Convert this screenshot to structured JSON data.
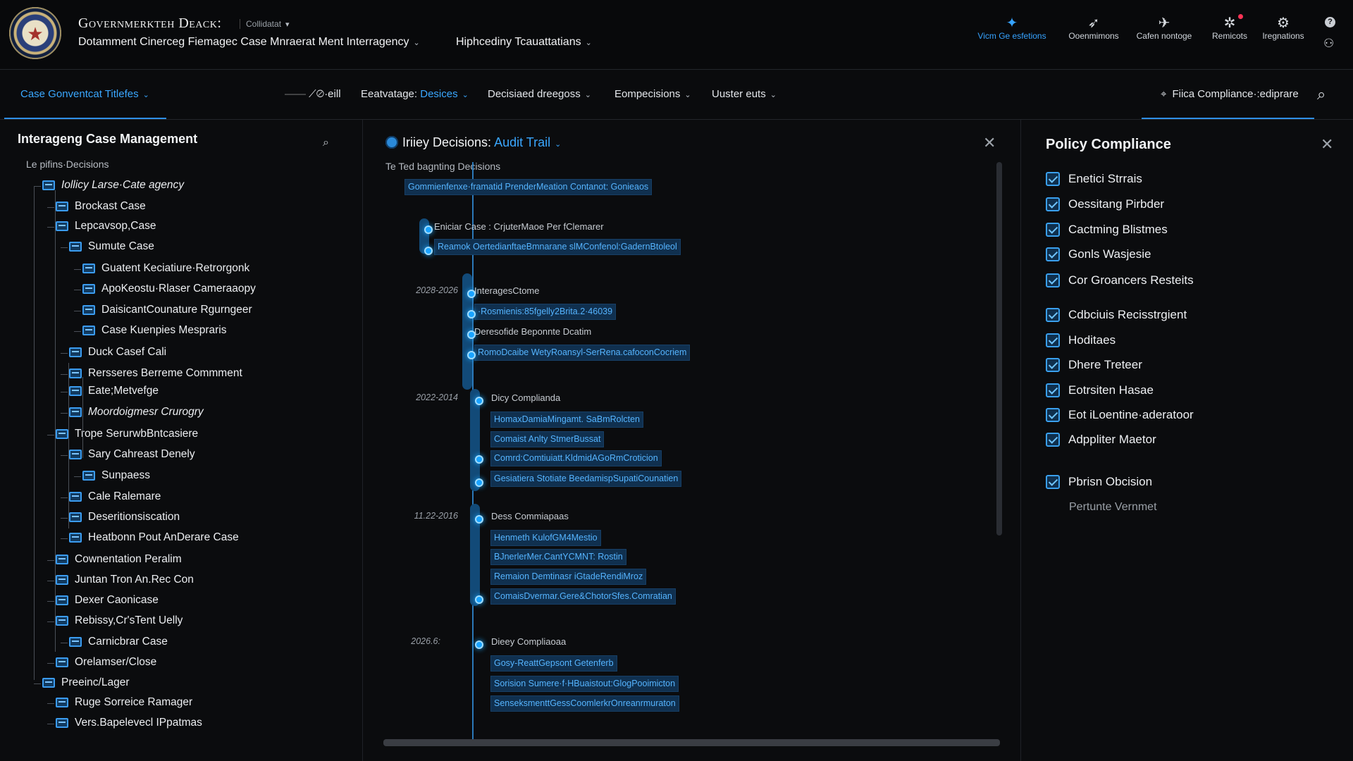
{
  "header": {
    "app_title": "Governmerkteh Deack:",
    "app_sub": "Collidatat",
    "breadcrumb_main": "Dotamment Cinerceg Fiemagec Case Mnraerat Ment Interragency",
    "breadcrumb_secondary": "Hiphcediny Tcauattatians",
    "actions": [
      {
        "label": "Vicm Ge esfetions",
        "icon": "shield-check-icon",
        "glyph": "✦",
        "active": true
      },
      {
        "label": "Ooenmimons",
        "icon": "paper-plane-icon",
        "glyph": "➶",
        "active": false
      },
      {
        "label": "Cafen nontoge",
        "icon": "rocket-icon",
        "glyph": "✈",
        "active": false
      },
      {
        "label": "Remicots",
        "icon": "gear-alert-icon",
        "glyph": "✲",
        "active": false
      },
      {
        "label": "Iregnations",
        "icon": "gears-icon",
        "glyph": "⚙",
        "active": false
      }
    ]
  },
  "nav": {
    "item1": "Case Gonventcat Titlefes",
    "item2": "⟋⊘·eill",
    "item3_prefix": "Eeatvatage:",
    "item3_value": "Desices",
    "item4": "Decisiaed dreegoss",
    "item5": "Eompecisions",
    "item6": "Uuster euts",
    "compliance": "Fiica Compliance·:ediprare"
  },
  "left": {
    "title": "Interageng Case Management",
    "caption": "Le pifins·Decisions",
    "tree": [
      {
        "label": "Iollicy Larse·Cate agency",
        "depth": 0,
        "italic": true
      },
      {
        "label": "Brockast Case",
        "depth": 1
      },
      {
        "label": "Lepcavsop,Case",
        "depth": 1
      },
      {
        "label": "Sumute Case",
        "depth": 2
      },
      {
        "label": "Guatent Keciatiure·Retrorgonk",
        "depth": 3
      },
      {
        "label": "ApoKeostu·Rlaser Cameraaopy",
        "depth": 3
      },
      {
        "label": "DaisicantCounature Rgurngeer",
        "depth": 3
      },
      {
        "label": "Case Kuenpies Mespraris",
        "depth": 3
      },
      {
        "label": "Duck Casef Cali",
        "depth": 2
      },
      {
        "label": "Rersseres Berreme Commment",
        "depth": 2
      },
      {
        "label": "Eate;Metvefge",
        "depth": 2
      },
      {
        "label": "Moordoigmesr Crurogry",
        "depth": 2,
        "italic": true
      },
      {
        "label": "Trope SerurwbBntcasiere",
        "depth": 1
      },
      {
        "label": "Sary Cahreast Denely",
        "depth": 2
      },
      {
        "label": "Sunpaess",
        "depth": 3
      },
      {
        "label": "Cale Ralemare",
        "depth": 2
      },
      {
        "label": "Deseritionsiscation",
        "depth": 2
      },
      {
        "label": "Heatbonn Pout AnDerare Case",
        "depth": 2
      },
      {
        "label": "Cownentation Peralim",
        "depth": 1
      },
      {
        "label": "Juntan Tron An.Rec Con",
        "depth": 1
      },
      {
        "label": "Dexer Caonicase",
        "depth": 1
      },
      {
        "label": "Rebissy,Cr'sTent Uelly",
        "depth": 1
      },
      {
        "label": "Carnicbrar Case",
        "depth": 2
      },
      {
        "label": "Orelamser/Close",
        "depth": 1
      },
      {
        "label": "Preeinc/Lager",
        "depth": 0
      },
      {
        "label": "Ruge Sorreice Ramager",
        "depth": 1
      },
      {
        "label": "Vers.Bapelevecl IPpatmas",
        "depth": 1
      }
    ]
  },
  "center": {
    "title_prefix": "Iriiey Decisions:",
    "title_value": "Audit Trail",
    "caption": "Te Ted bagnting Decisions",
    "root_item": "Gommienfenxe·framatid PrenderMeation Contanot: Gonieaos",
    "groups": [
      {
        "label": "Eniciar Case : CrjuterMaoe Per fClemarer",
        "date": "",
        "items": [
          "Reamok OertedianftaeBmnarane slMConfenol:GadernBtoleol"
        ]
      },
      {
        "label": "InteragesCtome",
        "date": "2028-2026",
        "items": [
          "·Rosmienis:85fgelly2Brita.2·46039"
        ]
      },
      {
        "label": "Deresofide Beponnte Dcatim",
        "date": "",
        "items": [
          "RomoDcaibe WetyRoansyl-SerRena.cafoconCocriem"
        ]
      },
      {
        "label": "Dicy Complianda",
        "date": "2022-2014",
        "items": [
          "HomaxDamiaMingamt. SaBmRolcten",
          "Comaist Anlty StmerBussat",
          "Comrd:Comtiuiatt.KldmidAGoRmCroticion",
          "Gesiatiera Stotiate BeedamispSupatiCounatien"
        ]
      },
      {
        "label": "Dess Commiapaas",
        "date": "11.22-2016",
        "items": [
          "Henmeth KulofGM4Mestio",
          "BJnerlerMer.CantYCMNT: Rostin",
          "Remaion Demtinasr iGtadeRendiMroz",
          "ComaisDvermar.Gere&ChotorSfes.Comratian"
        ]
      },
      {
        "label": "Dieey Compliaoaa",
        "date": "2026.6:",
        "items": [
          "Gosy-ReattGepsont Getenferb",
          "Sorision Sumere·f·HBuaistout:GlogPooimicton",
          "SenseksmenttGessCoomlerkrOnreanrmuraton"
        ]
      }
    ]
  },
  "right": {
    "title": "Policy Compliance",
    "items": [
      "Enetici Strrais",
      "Oessitang Pirbder",
      "Cactming Blistmes",
      "Gonls Wasjesie",
      "Cor Groancers Resteits",
      "Cdbciuis Recisstrgient",
      "Hoditaes",
      "Dhere Treteer",
      "Eotrsiten Hasae",
      "Eot iLoentine·aderatoor",
      "Adppliter Maetor",
      "Pbrisn Obcision"
    ],
    "footer_text": "Pertunte Vernmet"
  },
  "colors": {
    "accent": "#3aa7ff",
    "background": "#0b0c0e",
    "timeline_item_bg": "#10304f"
  }
}
